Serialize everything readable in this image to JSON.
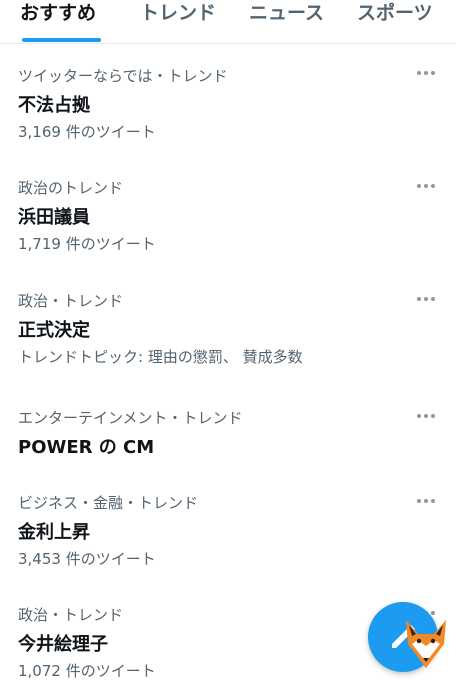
{
  "tabs": [
    {
      "label": "おすすめ",
      "active": true
    },
    {
      "label": "トレンド",
      "active": false
    },
    {
      "label": "ニュース",
      "active": false
    },
    {
      "label": "スポーツ",
      "active": false
    }
  ],
  "trends": [
    {
      "meta": "ツイッターならでは・トレンド",
      "name": "不法占拠",
      "sub": "3,169 件のツイート"
    },
    {
      "meta": "政治のトレンド",
      "name": "浜田議員",
      "sub": "1,719 件のツイート"
    },
    {
      "meta": "政治・トレンド",
      "name": "正式決定",
      "sub": "トレンドトピック: 理由の懲罰、 賛成多数"
    },
    {
      "meta": "エンターテインメント・トレンド",
      "name": "POWER の CM",
      "sub": ""
    },
    {
      "meta": "ビジネス・金融・トレンド",
      "name": "金利上昇",
      "sub": "3,453 件のツイート"
    },
    {
      "meta": "政治・トレンド",
      "name": "今井絵理子",
      "sub": "1,072 件のツイート"
    }
  ],
  "colors": {
    "accent": "#1d9bf0",
    "secondary_text": "#536471",
    "primary_text": "#0f1419"
  },
  "icons": {
    "more": "more-horizontal-icon",
    "fab": "compose-icon"
  }
}
